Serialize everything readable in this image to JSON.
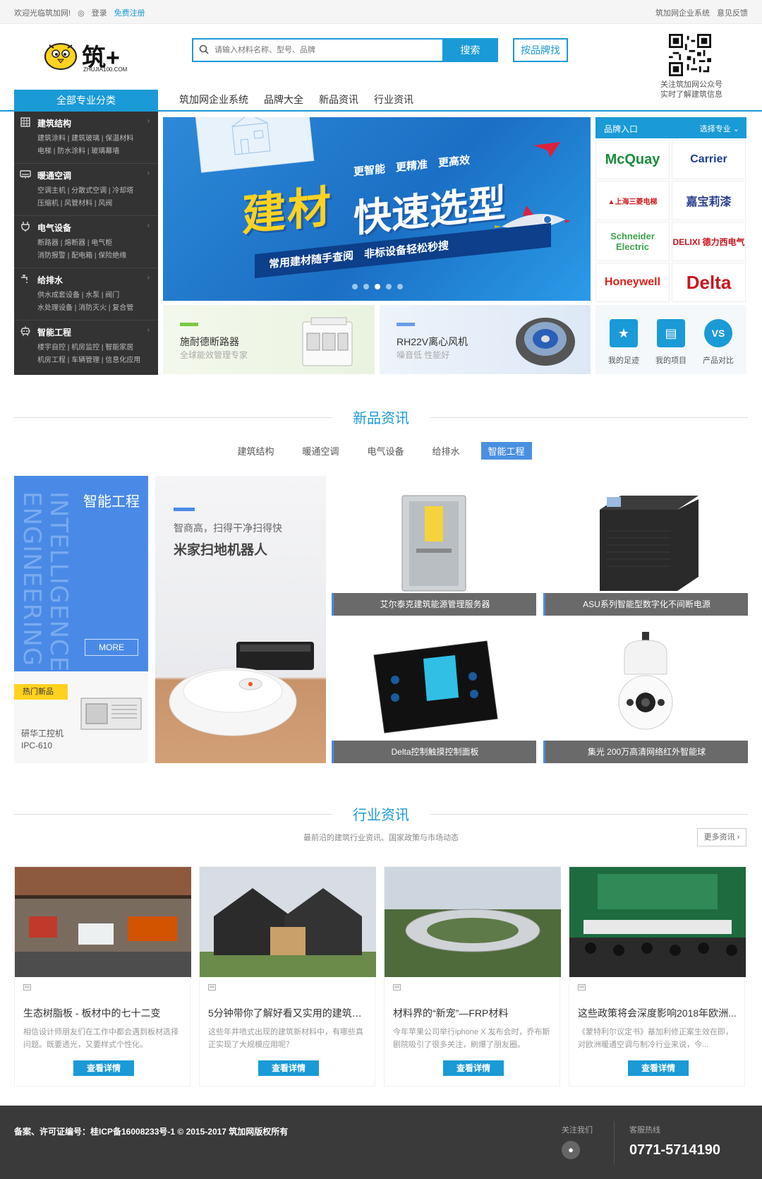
{
  "colors": {
    "accent": "#1a9ad6",
    "secondary": "#4a8ae6",
    "dark_sidebar": "#333333",
    "footer": "#3a3a3a",
    "highlight": "#ffd21f"
  },
  "topbar": {
    "welcome": "欢迎光临筑加网!",
    "login": "登录",
    "register": "免费注册",
    "enterprise": "筑加网企业系统",
    "feedback": "意见反馈"
  },
  "logo": {
    "text": "筑+",
    "sub": "ZHUJIA100.COM"
  },
  "search": {
    "placeholder": "请输入材料名称、型号、品牌",
    "button": "搜索",
    "brand_button": "按品牌找"
  },
  "qr": {
    "line1": "关注筑加网公众号",
    "line2": "实时了解建筑信息"
  },
  "nav": {
    "all_categories": "全部专业分类",
    "items": [
      "筑加网企业系统",
      "品牌大全",
      "新品资讯",
      "行业资讯"
    ]
  },
  "categories": [
    {
      "title": "建筑结构",
      "icon": "building-icon",
      "sub1": "建筑涂料 | 建筑玻璃 | 保温材料",
      "sub2": "电梯 | 防水涂料 | 玻璃幕墙"
    },
    {
      "title": "暖通空调",
      "icon": "air-conditioner-icon",
      "sub1": "空调主机 | 分散式空调 | 冷却塔",
      "sub2": "压缩机 | 风管材料 | 风阀"
    },
    {
      "title": "电气设备",
      "icon": "plug-icon",
      "sub1": "断路器 | 熔断器 | 电气柜",
      "sub2": "消防报警 | 配电箱 | 保险绝缘"
    },
    {
      "title": "给排水",
      "icon": "faucet-icon",
      "sub1": "供水成套设备 | 水泵 | 阀门",
      "sub2": "水处理设备 | 消防灭火 | 复合管"
    },
    {
      "title": "智能工程",
      "icon": "robot-icon",
      "sub1": "楼宇自控 | 机房监控 | 智能家居",
      "sub2": "机房工程 | 车辆管理 | 信息化应用"
    }
  ],
  "banner": {
    "title1": "建材",
    "title2": "快速选型",
    "tagline": "更智能　更精准　更高效",
    "strip": "常用建材随手查阅　非标设备轻松秒搜"
  },
  "sub_banners": [
    {
      "title": "施耐德断路器",
      "subtitle": "全球能效管理专家",
      "bar": "#7ac943"
    },
    {
      "title": "RH22V离心风机",
      "subtitle": "噪音低 性能好",
      "bar": "#6a9ee8"
    }
  ],
  "brand_panel": {
    "title": "品牌入口",
    "select": "选择专业 ⌄",
    "brands": [
      {
        "name": "McQuay",
        "color": "#1a8c3a",
        "size": "20px"
      },
      {
        "name": "Carrier",
        "color": "#1b3f8f",
        "size": "16px"
      },
      {
        "name": "▲上海三菱电梯",
        "color": "#cc1f1f",
        "size": "10px"
      },
      {
        "name": "嘉宝莉漆",
        "color": "#2a3e8f",
        "size": "16px"
      },
      {
        "name": "Schneider Electric",
        "color": "#3aa34a",
        "size": "13px"
      },
      {
        "name": "DELIXI 德力西电气",
        "color": "#c8161d",
        "size": "12px"
      },
      {
        "name": "Honeywell",
        "color": "#e0201b",
        "size": "16px"
      },
      {
        "name": "Delta",
        "color": "#c8161d",
        "size": "26px"
      }
    ]
  },
  "quick_links": [
    {
      "label": "我的足迹",
      "glyph": "★"
    },
    {
      "label": "我的项目",
      "glyph": "▤"
    },
    {
      "label": "产品对比",
      "glyph": "VS"
    }
  ],
  "new_products": {
    "section_title": "新品资讯",
    "tabs": [
      "建筑结构",
      "暖通空调",
      "电气设备",
      "给排水",
      "智能工程"
    ],
    "active_tab": 4,
    "feature": {
      "title": "智能工程",
      "english": "INTELLIGENCE ENGINEERING",
      "more": "MORE"
    },
    "hot": {
      "tag": "热门新品",
      "name_line1": "研华工控机",
      "name_line2": "IPC-610"
    },
    "robot": {
      "line1": "智商高，扫得干净扫得快",
      "line2": "米家扫地机器人"
    },
    "items": [
      "艾尔泰克建筑能源管理服务器",
      "ASU系列智能型数字化不间断电源",
      "Delta控制触摸控制面板",
      "集光 200万高清网络红外智能球"
    ]
  },
  "industry": {
    "section_title": "行业资讯",
    "subtitle": "最前沿的建筑行业资讯、国家政策与市场动态",
    "more": "更多资讯 ›",
    "articles": [
      {
        "title": "生态树脂板 - 板材中的七十二变",
        "desc": "相信设计师朋友们在工作中都会遇到板材选择问题。既要透光，又要样式个性化。",
        "button": "查看详情"
      },
      {
        "title": "5分钟带你了解好看又实用的建筑新...",
        "desc": "这些年井喷式出现的建筑新材料中，有哪些真正实现了大规模应用呢？",
        "button": "查看详情"
      },
      {
        "title": "材料界的“新宠”—FRP材料",
        "desc": "今年苹果公司举行iphone X 发布会时，乔布斯剧院吸引了很多关注，刷爆了朋友圈。",
        "button": "查看详情"
      },
      {
        "title": "这些政策将会深度影响2018年欧洲...",
        "desc": "《蒙特利尔议定书》基加利修正案生效在即，对欧洲暖通空调与制冷行业来说，今...",
        "button": "查看详情"
      }
    ]
  },
  "footer": {
    "copyright": "备案、许可证编号：桂ICP备16008233号-1 © 2015-2017 筑加网版权所有",
    "follow": "关注我们",
    "hotline_label": "客服热线",
    "phone": "0771-5714190"
  }
}
